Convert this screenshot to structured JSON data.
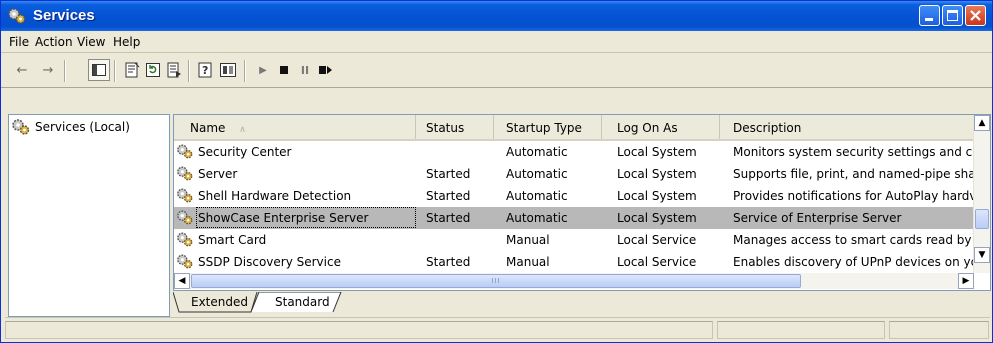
{
  "window": {
    "title": "Services",
    "icons": {
      "app": "gears-icon",
      "minimize": "minimize-icon",
      "maximize": "maximize-icon",
      "close": "close-icon"
    }
  },
  "menu": [
    "File",
    "Action",
    "View",
    "Help"
  ],
  "toolbar": {
    "icons": [
      "back-arrow-icon",
      "forward-arrow-icon",
      "show-hide-console-tree-icon",
      "properties-icon",
      "refresh-icon",
      "export-list-icon",
      "help-icon",
      "view-icon",
      "start-service-icon",
      "stop-service-icon",
      "pause-service-icon",
      "restart-service-icon"
    ]
  },
  "tree": {
    "root": "Services (Local)"
  },
  "list": {
    "columns": [
      "Name",
      "Status",
      "Startup Type",
      "Log On As",
      "Description"
    ],
    "sort_indicator": "∧",
    "rows": [
      {
        "name": "Security Center",
        "status": "",
        "startup": "Automatic",
        "logon": "Local System",
        "description": "Monitors system security settings and cc"
      },
      {
        "name": "Server",
        "status": "Started",
        "startup": "Automatic",
        "logon": "Local System",
        "description": "Supports file, print, and named-pipe sha"
      },
      {
        "name": "Shell Hardware Detection",
        "status": "Started",
        "startup": "Automatic",
        "logon": "Local System",
        "description": "Provides notifications for AutoPlay hardv"
      },
      {
        "name": "ShowCase Enterprise Server",
        "status": "Started",
        "startup": "Automatic",
        "logon": "Local System",
        "description": "Service of Enterprise Server",
        "selected": true
      },
      {
        "name": "Smart Card",
        "status": "",
        "startup": "Manual",
        "logon": "Local Service",
        "description": "Manages access to smart cards read by"
      },
      {
        "name": "SSDP Discovery Service",
        "status": "Started",
        "startup": "Manual",
        "logon": "Local Service",
        "description": "Enables discovery of UPnP devices on yc"
      }
    ],
    "hscroll_grip": "III"
  },
  "tabs": [
    "Extended",
    "Standard"
  ],
  "active_tab": "Standard",
  "colors": {
    "titlebar": "#0553d4",
    "selection": "#b8b8b8",
    "chrome": "#ece9d8"
  }
}
